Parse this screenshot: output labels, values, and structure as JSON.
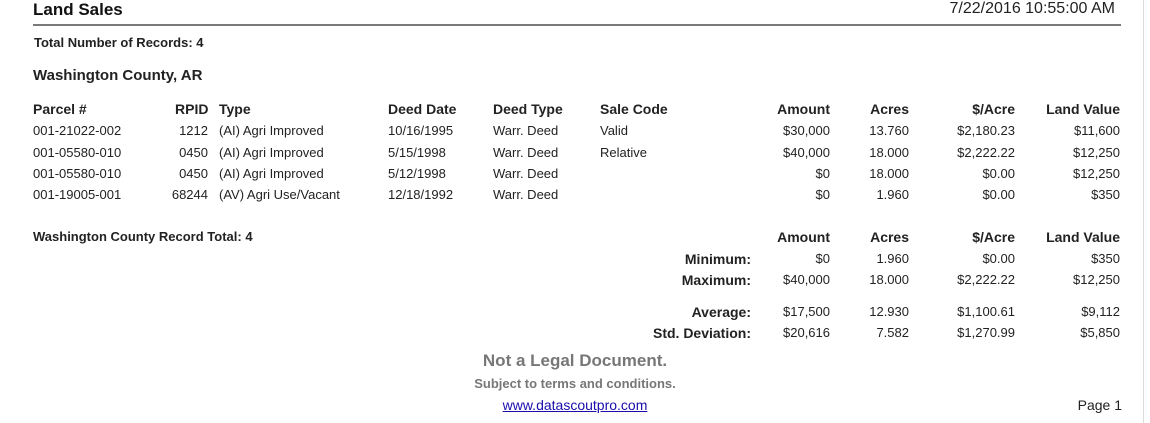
{
  "report": {
    "title": "Land Sales",
    "datetime": "7/22/2016 10:55:00 AM",
    "total_records": "Total Number of Records: 4",
    "county": "Washington County, AR",
    "record_total": "Washington County Record Total: 4"
  },
  "columns": {
    "parcel": "Parcel #",
    "rpid": "RPID",
    "type": "Type",
    "deed_date": "Deed Date",
    "deed_type": "Deed Type",
    "sale_code": "Sale Code",
    "amount": "Amount",
    "acres": "Acres",
    "per_acre": "$/Acre",
    "land_value": "Land Value"
  },
  "rows": [
    {
      "parcel": "001-21022-002",
      "rpid": "1212",
      "type": "(AI) Agri Improved",
      "deed_date": "10/16/1995",
      "deed_type": "Warr. Deed",
      "sale_code": "Valid",
      "amount": "$30,000",
      "acres": "13.760",
      "per_acre": "$2,180.23",
      "land_value": "$11,600"
    },
    {
      "parcel": "001-05580-010",
      "rpid": "0450",
      "type": "(AI) Agri Improved",
      "deed_date": "5/15/1998",
      "deed_type": "Warr. Deed",
      "sale_code": "Relative",
      "amount": "$40,000",
      "acres": "18.000",
      "per_acre": "$2,222.22",
      "land_value": "$12,250"
    },
    {
      "parcel": "001-05580-010",
      "rpid": "0450",
      "type": "(AI) Agri Improved",
      "deed_date": "5/12/1998",
      "deed_type": "Warr. Deed",
      "sale_code": "",
      "amount": "$0",
      "acres": "18.000",
      "per_acre": "$0.00",
      "land_value": "$12,250"
    },
    {
      "parcel": "001-19005-001",
      "rpid": "68244",
      "type": "(AV) Agri Use/Vacant",
      "deed_date": "12/18/1992",
      "deed_type": "Warr. Deed",
      "sale_code": "",
      "amount": "$0",
      "acres": "1.960",
      "per_acre": "$0.00",
      "land_value": "$350"
    }
  ],
  "stats": [
    {
      "label": "Minimum:",
      "amount": "$0",
      "acres": "1.960",
      "per_acre": "$0.00",
      "land_value": "$350"
    },
    {
      "label": "Maximum:",
      "amount": "$40,000",
      "acres": "18.000",
      "per_acre": "$2,222.22",
      "land_value": "$12,250"
    },
    {
      "label": "Average:",
      "amount": "$17,500",
      "acres": "12.930",
      "per_acre": "$1,100.61",
      "land_value": "$9,112"
    },
    {
      "label": "Std. Deviation:",
      "amount": "$20,616",
      "acres": "7.582",
      "per_acre": "$1,270.99",
      "land_value": "$5,850"
    }
  ],
  "footer": {
    "disclaimer": "Not a Legal Document.",
    "terms": "Subject to terms and conditions.",
    "link": "www.datascoutpro.com",
    "page": "Page 1"
  }
}
